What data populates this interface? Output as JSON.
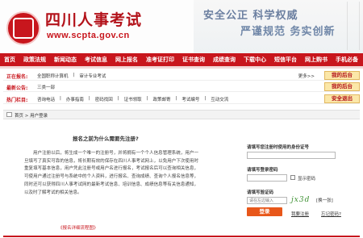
{
  "header": {
    "site_title": "四川人事考试",
    "site_url": "www.scpta.gov.cn",
    "slogan_1": "安全公正  科学权威",
    "slogan_2": "严谨规范  务实创新"
  },
  "nav": {
    "items": [
      "首页",
      "政策法规",
      "新闻动态",
      "考试信息",
      "网上报名",
      "准考证打印",
      "证书查询",
      "成绩查询",
      "下载中心",
      "短信平台",
      "网上购书",
      "手机必备"
    ]
  },
  "rows": {
    "apply": {
      "label": "正在报名:",
      "items": [
        "全国职称计算机",
        "审计专业考试"
      ],
      "more": "更多>>",
      "side_button": "我的后台"
    },
    "notice": {
      "label": "最新公告:",
      "items": [
        "三类一部"
      ],
      "side_button": "我的后台"
    },
    "hot": {
      "label": "热门栏目:",
      "items": [
        "咨询电话",
        "办事指南",
        "密码找回",
        "证书领取",
        "政策邮寄",
        "考试编号",
        "互动交流"
      ],
      "side_button": "安全退出"
    }
  },
  "breadcrumb": {
    "text": "首页 > 用户登录"
  },
  "content": {
    "title": "报名之前为什么需要先注册?",
    "body": "用户注册以后，将生成一个唯一的注册号，并将拥有一个个人信息管理系统，用户一旦填写了真实可靠的信息，将长期有效的保存在四川人事考试网上，以免用户下次使用时重复填写基本信息，用户凭此注册号或用户名进行报名，考试报名后可以查询相关信息，可使用户通过注册号与系统中的个人资料，进行报名、查询成绩、查询个人报名信息等，同时还可以获得四川人事考试网的最新考试信息、培训信息、成绩信息等有关信息通知，以及时了解考试的相关信息。",
    "link": "《报名详细流程图》"
  },
  "login": {
    "id_label": "请填写您注册时使用的身份证号",
    "password_label": "请填写登录密码",
    "show_password_label": "显示密码",
    "captcha_label": "请填写验证码",
    "captcha_placeholder": "请在左边输入",
    "captcha_text": "jx3d",
    "captcha_refresh": "[换一张]",
    "login_button": "登录",
    "register_link": "我要注册",
    "forgot_link": "忘记密码?"
  },
  "colors": {
    "brand_red": "#c8161d",
    "login_orange": "#e8571a",
    "side_button_bg": "#fbe7a8"
  }
}
